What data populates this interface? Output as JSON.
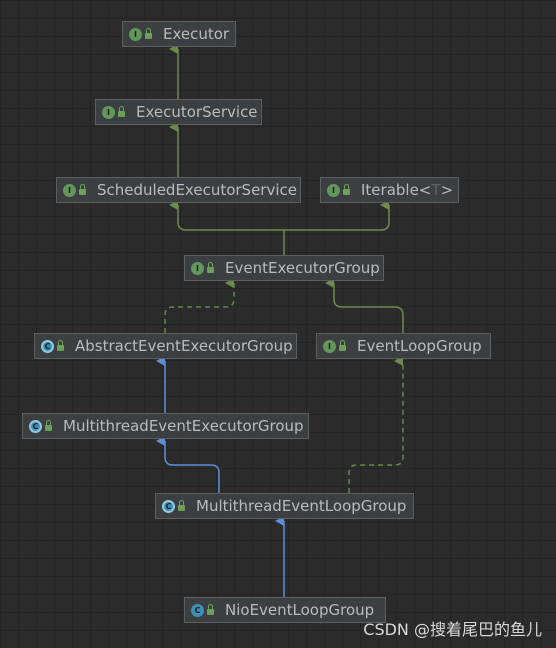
{
  "colors": {
    "background": "#2b2b2b",
    "node_fill": "#3c3f41",
    "node_border": "#5e6060",
    "text": "#bbbbbb",
    "extends_edge": "#6a8d4e",
    "implements_edge": "#5f8c4a",
    "class_extends_edge": "#5b8fd6"
  },
  "nodes": {
    "executor": {
      "label": "Executor",
      "kind": "interface",
      "badge": "I"
    },
    "executor_service": {
      "label": "ExecutorService",
      "kind": "interface",
      "badge": "I"
    },
    "scheduled_executor_service": {
      "label": "ScheduledExecutorService",
      "kind": "interface",
      "badge": "I"
    },
    "iterable": {
      "label": "Iterable<",
      "type_param": "T",
      "label_close": ">",
      "kind": "interface",
      "badge": "I"
    },
    "event_executor_group": {
      "label": "EventExecutorGroup",
      "kind": "interface",
      "badge": "I"
    },
    "abstract_event_executor_group": {
      "label": "AbstractEventExecutorGroup",
      "kind": "abstract-class",
      "badge": "C"
    },
    "event_loop_group": {
      "label": "EventLoopGroup",
      "kind": "interface",
      "badge": "I"
    },
    "multithread_event_executor_group": {
      "label": "MultithreadEventExecutorGroup",
      "kind": "abstract-class",
      "badge": "C"
    },
    "multithread_event_loop_group": {
      "label": "MultithreadEventLoopGroup",
      "kind": "abstract-class",
      "badge": "C"
    },
    "nio_event_loop_group": {
      "label": "NioEventLoopGroup",
      "kind": "class",
      "badge": "C"
    }
  },
  "edges": [
    {
      "from": "executor_service",
      "to": "executor",
      "type": "interface-extends"
    },
    {
      "from": "scheduled_executor_service",
      "to": "executor_service",
      "type": "interface-extends"
    },
    {
      "from": "event_executor_group",
      "to": "scheduled_executor_service",
      "type": "interface-extends"
    },
    {
      "from": "event_executor_group",
      "to": "iterable",
      "type": "interface-extends"
    },
    {
      "from": "abstract_event_executor_group",
      "to": "event_executor_group",
      "type": "implements"
    },
    {
      "from": "event_loop_group",
      "to": "event_executor_group",
      "type": "interface-extends"
    },
    {
      "from": "multithread_event_executor_group",
      "to": "abstract_event_executor_group",
      "type": "class-extends"
    },
    {
      "from": "multithread_event_loop_group",
      "to": "multithread_event_executor_group",
      "type": "class-extends"
    },
    {
      "from": "multithread_event_loop_group",
      "to": "event_loop_group",
      "type": "implements"
    },
    {
      "from": "nio_event_loop_group",
      "to": "multithread_event_loop_group",
      "type": "class-extends"
    }
  ],
  "watermark": "CSDN @搜着尾巴的鱼儿"
}
